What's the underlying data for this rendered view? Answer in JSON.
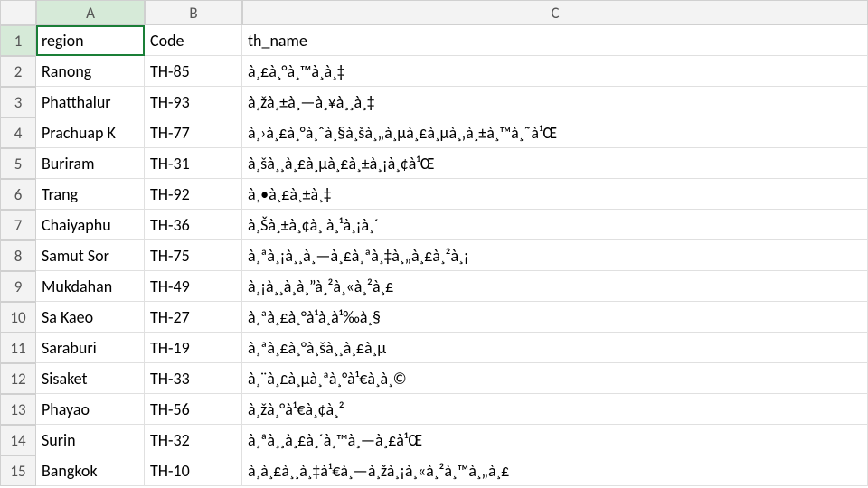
{
  "columns": [
    "A",
    "B",
    "C"
  ],
  "headers": {
    "A": "region",
    "B": "Code",
    "C": "th_name"
  },
  "selected_cell": "A1",
  "rows": [
    {
      "n": 1,
      "A": "region",
      "B": "Code",
      "C": "th_name"
    },
    {
      "n": 2,
      "A": "Ranong",
      "B": "TH-85",
      "C": "à¸£à¸°à¸™à¸­à¸‡"
    },
    {
      "n": 3,
      "A": "Phatthalur",
      "B": "TH-93",
      "C": "à¸žà¸±à¸—à¸¥à¸¸à¸‡"
    },
    {
      "n": 4,
      "A": "Prachuap K",
      "B": "TH-77",
      "C": "à¸›à¸£à¸°à¸ˆà¸§à¸šà¸„à¸µà¸£à¸µà¸‚à¸±à¸™à¸˜à¹Œ"
    },
    {
      "n": 5,
      "A": "Buriram",
      "B": "TH-31",
      "C": "à¸šà¸¸à¸£à¸µà¸£à¸±à¸¡à¸¢à¹Œ"
    },
    {
      "n": 6,
      "A": "Trang",
      "B": "TH-92",
      "C": "à¸•à¸£à¸±à¸‡"
    },
    {
      "n": 7,
      "A": "Chaiyaphu",
      "B": "TH-36",
      "C": "à¸Šà¸±à¸¢à¸ à¸¹à¸¡à¸´"
    },
    {
      "n": 8,
      "A": "Samut Sor",
      "B": "TH-75",
      "C": "à¸ªà¸¡à¸¸à¸—à¸£à¸ªà¸‡à¸„à¸£à¸²à¸¡"
    },
    {
      "n": 9,
      "A": "Mukdahan",
      "B": "TH-49",
      "C": "à¸¡à¸¸à¸à¸”à¸²à¸«à¸²à¸£"
    },
    {
      "n": 10,
      "A": "Sa Kaeo",
      "B": "TH-27",
      "C": "à¸ªà¸£à¸°à¹à¸à¹‰à¸§"
    },
    {
      "n": 11,
      "A": "Saraburi",
      "B": "TH-19",
      "C": "à¸ªà¸£à¸°à¸šà¸¸à¸£à¸µ"
    },
    {
      "n": 12,
      "A": "Sisaket",
      "B": "TH-33",
      "C": "à¸¨à¸£à¸µà¸ªà¸°à¹€à¸à¸©"
    },
    {
      "n": 13,
      "A": "Phayao",
      "B": "TH-56",
      "C": "à¸žà¸°à¹€à¸¢à¸²"
    },
    {
      "n": 14,
      "A": "Surin",
      "B": "TH-32",
      "C": "à¸ªà¸¸à¸£à¸´à¸™à¸—à¸£à¹Œ"
    },
    {
      "n": 15,
      "A": "Bangkok",
      "B": "TH-10",
      "C": "à¸à¸£à¸¸à¸‡à¹€à¸—à¸žà¸¡à¸«à¸²à¸™à¸„à¸£"
    }
  ]
}
